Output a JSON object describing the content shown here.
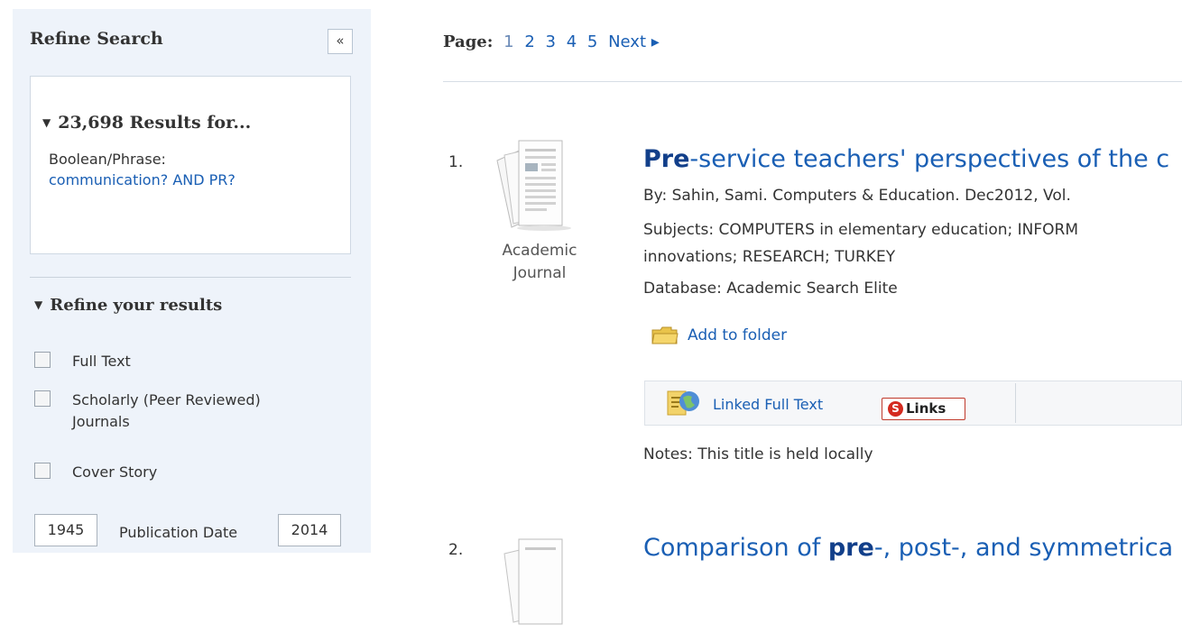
{
  "sidebar": {
    "title": "Refine Search",
    "collapse_label": "«",
    "results_heading": "23,698 Results for...",
    "query_label": "Boolean/Phrase:",
    "query_value": "communication? AND PR?",
    "refine_heading": "Refine your results",
    "filters": [
      {
        "label": "Full Text",
        "checked": false
      },
      {
        "label": "Scholarly (Peer Reviewed) Journals",
        "checked": false
      },
      {
        "label": "Cover Story",
        "checked": false
      }
    ],
    "date_from": "1945",
    "date_label": "Publication Date",
    "date_to": "2014"
  },
  "pager": {
    "label": "Page:",
    "pages": [
      "1",
      "2",
      "3",
      "4",
      "5"
    ],
    "current": "1",
    "next": "Next ▸"
  },
  "results": [
    {
      "number": "1.",
      "type_line1": "Academic",
      "type_line2": "Journal",
      "title_highlight": "Pre",
      "title_rest": "-service teachers' perspectives of the c",
      "byline": "By: Sahin, Sami. Computers & Education. Dec2012, Vol.",
      "subjects_line1": "Subjects: COMPUTERS in elementary education; INFORM",
      "subjects_line2": "innovations; RESEARCH; TURKEY",
      "database": "Database: Academic Search Elite",
      "add_to_folder": "Add to folder",
      "linked_full_text": "Linked Full Text",
      "links_button": "Links",
      "notes": "Notes:  This title is held locally"
    },
    {
      "number": "2.",
      "title_prefix": "Comparison of ",
      "title_highlight": "pre",
      "title_rest": "-, post-, and symmetrica"
    }
  ],
  "colors": {
    "link": "#1a5fb4",
    "sidebar_bg": "#eef3fa",
    "sfx_red": "#d42a1f"
  }
}
